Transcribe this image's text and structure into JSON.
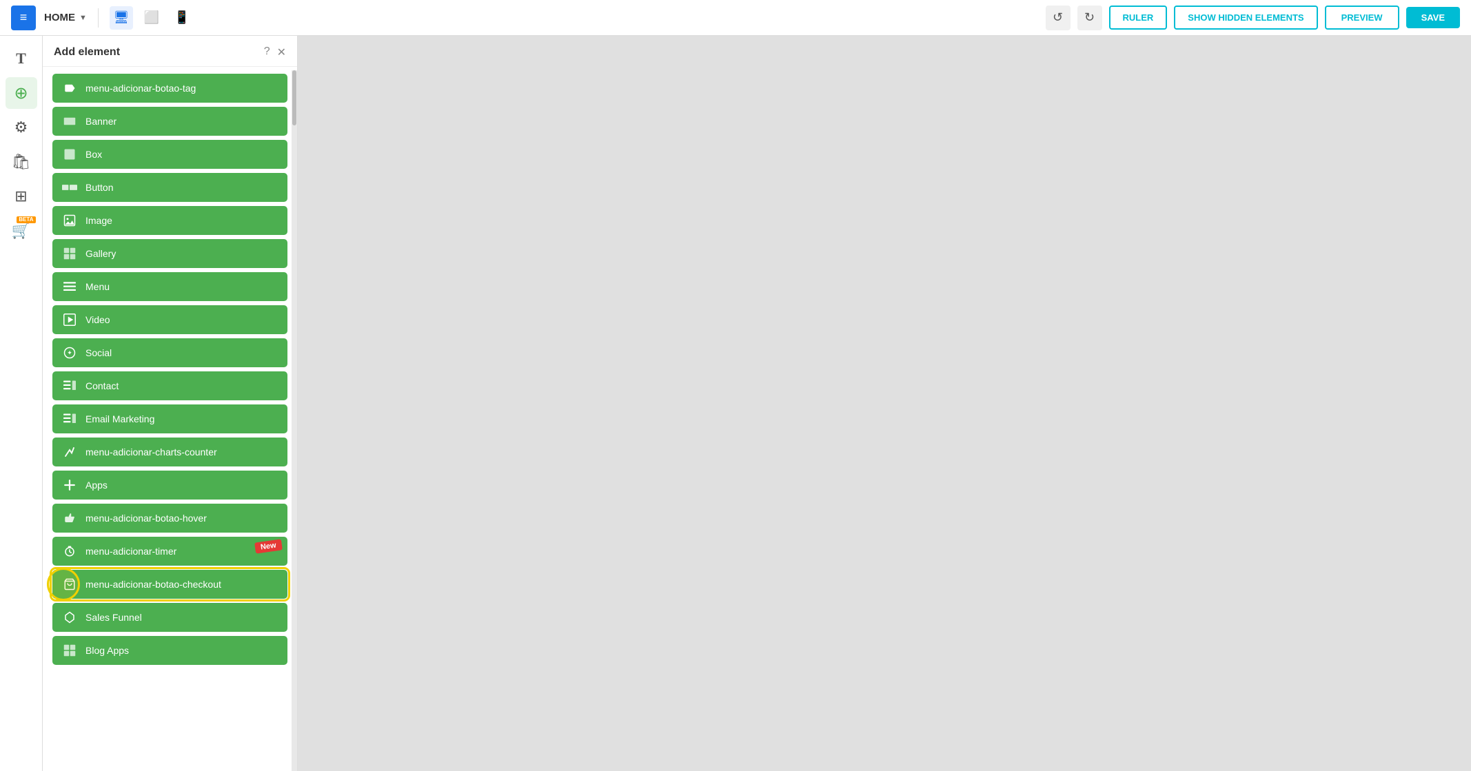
{
  "topbar": {
    "logo_icon": "≡",
    "home_label": "HOME",
    "chevron_icon": "▼",
    "undo_icon": "↺",
    "redo_icon": "↻",
    "ruler_label": "RULER",
    "show_hidden_label": "SHOW HIDDEN ELEMENTS",
    "preview_label": "PREVIEW",
    "save_label": "SAVE"
  },
  "left_sidebar": {
    "icons": [
      {
        "name": "text-icon",
        "symbol": "T",
        "active": false
      },
      {
        "name": "add-element-icon",
        "symbol": "⊕",
        "active": true
      },
      {
        "name": "settings-icon",
        "symbol": "⚙",
        "active": false
      },
      {
        "name": "store-icon",
        "symbol": "🛍",
        "active": false
      },
      {
        "name": "table-icon",
        "symbol": "⊞",
        "active": false
      },
      {
        "name": "beta-apps-icon",
        "symbol": "🛒",
        "active": false,
        "beta": true
      }
    ]
  },
  "panel": {
    "title": "Add element",
    "help_icon": "?",
    "close_icon": "✕",
    "elements": [
      {
        "name": "menu-adicionar-botao-tag",
        "label": "menu-adicionar-botao-tag",
        "icon": "🏷"
      },
      {
        "name": "banner",
        "label": "Banner",
        "icon": "▬"
      },
      {
        "name": "box",
        "label": "Box",
        "icon": "▪"
      },
      {
        "name": "button",
        "label": "Button",
        "icon": "▬▬"
      },
      {
        "name": "image",
        "label": "Image",
        "icon": "🖼"
      },
      {
        "name": "gallery",
        "label": "Gallery",
        "icon": "⊞"
      },
      {
        "name": "menu",
        "label": "Menu",
        "icon": "≡"
      },
      {
        "name": "video",
        "label": "Video",
        "icon": "▶"
      },
      {
        "name": "social",
        "label": "Social",
        "icon": "✦"
      },
      {
        "name": "contact",
        "label": "Contact",
        "icon": "≡▪"
      },
      {
        "name": "email-marketing",
        "label": "Email Marketing",
        "icon": "≡▪"
      },
      {
        "name": "menu-adicionar-charts-counter",
        "label": "menu-adicionar-charts-counter",
        "icon": "↗"
      },
      {
        "name": "apps",
        "label": "Apps",
        "icon": "+"
      },
      {
        "name": "menu-adicionar-botao-hover",
        "label": "menu-adicionar-botao-hover",
        "icon": "☞"
      },
      {
        "name": "menu-adicionar-timer",
        "label": "menu-adicionar-timer",
        "icon": "⏱",
        "new": true
      },
      {
        "name": "menu-adicionar-botao-checkout",
        "label": "menu-adicionar-botao-checkout",
        "icon": "🛒",
        "highlighted": true
      },
      {
        "name": "sales-funnel",
        "label": "Sales Funnel",
        "icon": "▢"
      },
      {
        "name": "blog-apps",
        "label": "Blog Apps",
        "icon": "⊞"
      }
    ]
  }
}
